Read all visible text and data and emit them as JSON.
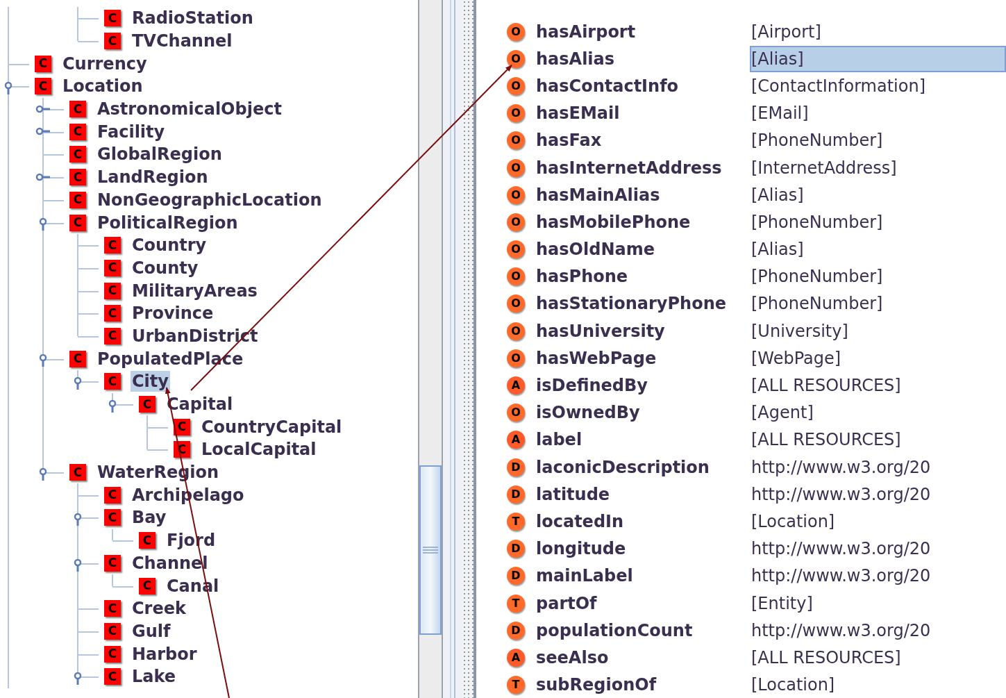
{
  "class_tree": [
    {
      "children": [
        {
          "children": [
            {
              "icon": "C",
              "label": "RadioStation",
              "selected": false
            },
            {
              "icon": "C",
              "label": "TVChannel",
              "selected": false
            }
          ]
        }
      ]
    },
    {
      "icon": "C",
      "label": "Currency",
      "selected": false
    },
    {
      "icon": "C",
      "label": "Location",
      "selected": false,
      "expanded": true,
      "children": [
        {
          "icon": "C",
          "label": "AstronomicalObject",
          "selected": false,
          "expanded": false
        },
        {
          "icon": "C",
          "label": "Facility",
          "selected": false,
          "expanded": false
        },
        {
          "icon": "C",
          "label": "GlobalRegion",
          "selected": false
        },
        {
          "icon": "C",
          "label": "LandRegion",
          "selected": false,
          "expanded": false
        },
        {
          "icon": "C",
          "label": "NonGeographicLocation",
          "selected": false
        },
        {
          "icon": "C",
          "label": "PoliticalRegion",
          "selected": false,
          "expanded": true,
          "children": [
            {
              "icon": "C",
              "label": "Country",
              "selected": false
            },
            {
              "icon": "C",
              "label": "County",
              "selected": false
            },
            {
              "icon": "C",
              "label": "MilitaryAreas",
              "selected": false
            },
            {
              "icon": "C",
              "label": "Province",
              "selected": false
            },
            {
              "icon": "C",
              "label": "UrbanDistrict",
              "selected": false
            }
          ]
        },
        {
          "icon": "C",
          "label": "PopulatedPlace",
          "selected": false,
          "expanded": true,
          "children": [
            {
              "icon": "C",
              "label": "City",
              "selected": true,
              "expanded": true,
              "children": [
                {
                  "icon": "C",
                  "label": "Capital",
                  "selected": false,
                  "expanded": true,
                  "children": [
                    {
                      "icon": "C",
                      "label": "CountryCapital",
                      "selected": false
                    },
                    {
                      "icon": "C",
                      "label": "LocalCapital",
                      "selected": false
                    }
                  ]
                }
              ]
            }
          ]
        },
        {
          "icon": "C",
          "label": "WaterRegion",
          "selected": false,
          "expanded": true,
          "children": [
            {
              "icon": "C",
              "label": "Archipelago",
              "selected": false
            },
            {
              "icon": "C",
              "label": "Bay",
              "selected": false,
              "expanded": true,
              "children": [
                {
                  "icon": "C",
                  "label": "Fjord",
                  "selected": false
                }
              ]
            },
            {
              "icon": "C",
              "label": "Channel",
              "selected": false,
              "expanded": true,
              "children": [
                {
                  "icon": "C",
                  "label": "Canal",
                  "selected": false
                }
              ]
            },
            {
              "icon": "C",
              "label": "Creek",
              "selected": false
            },
            {
              "icon": "C",
              "label": "Gulf",
              "selected": false
            },
            {
              "icon": "C",
              "label": "Harbor",
              "selected": false
            },
            {
              "icon": "C",
              "label": "Lake",
              "selected": false,
              "expanded": true
            }
          ]
        }
      ]
    }
  ],
  "properties": [
    {
      "icon": "O",
      "name": "hasAirport",
      "range": "[Airport]",
      "selected": false
    },
    {
      "icon": "O",
      "name": "hasAlias",
      "range": "[Alias]",
      "selected": true
    },
    {
      "icon": "O",
      "name": "hasContactInfo",
      "range": "[ContactInformation]",
      "selected": false
    },
    {
      "icon": "O",
      "name": "hasEMail",
      "range": "[EMail]",
      "selected": false
    },
    {
      "icon": "O",
      "name": "hasFax",
      "range": "[PhoneNumber]",
      "selected": false
    },
    {
      "icon": "O",
      "name": "hasInternetAddress",
      "range": "[InternetAddress]",
      "selected": false
    },
    {
      "icon": "O",
      "name": "hasMainAlias",
      "range": "[Alias]",
      "selected": false
    },
    {
      "icon": "O",
      "name": "hasMobilePhone",
      "range": "[PhoneNumber]",
      "selected": false
    },
    {
      "icon": "O",
      "name": "hasOldName",
      "range": "[Alias]",
      "selected": false
    },
    {
      "icon": "O",
      "name": "hasPhone",
      "range": "[PhoneNumber]",
      "selected": false
    },
    {
      "icon": "O",
      "name": "hasStationaryPhone",
      "range": "[PhoneNumber]",
      "selected": false
    },
    {
      "icon": "O",
      "name": "hasUniversity",
      "range": "[University]",
      "selected": false
    },
    {
      "icon": "O",
      "name": "hasWebPage",
      "range": "[WebPage]",
      "selected": false
    },
    {
      "icon": "A",
      "name": "isDefinedBy",
      "range": "[ALL RESOURCES]",
      "selected": false
    },
    {
      "icon": "O",
      "name": "isOwnedBy",
      "range": "[Agent]",
      "selected": false
    },
    {
      "icon": "A",
      "name": "label",
      "range": "[ALL RESOURCES]",
      "selected": false
    },
    {
      "icon": "D",
      "name": "laconicDescription",
      "range": "http://www.w3.org/20",
      "selected": false
    },
    {
      "icon": "D",
      "name": "latitude",
      "range": "http://www.w3.org/20",
      "selected": false
    },
    {
      "icon": "T",
      "name": "locatedIn",
      "range": "[Location]",
      "selected": false
    },
    {
      "icon": "D",
      "name": "longitude",
      "range": "http://www.w3.org/20",
      "selected": false
    },
    {
      "icon": "D",
      "name": "mainLabel",
      "range": "http://www.w3.org/20",
      "selected": false
    },
    {
      "icon": "T",
      "name": "partOf",
      "range": "[Entity]",
      "selected": false
    },
    {
      "icon": "D",
      "name": "populationCount",
      "range": "http://www.w3.org/20",
      "selected": false
    },
    {
      "icon": "A",
      "name": "seeAlso",
      "range": "[ALL RESOURCES]",
      "selected": false
    },
    {
      "icon": "T",
      "name": "subRegionOf",
      "range": "[Location]",
      "selected": false
    }
  ]
}
